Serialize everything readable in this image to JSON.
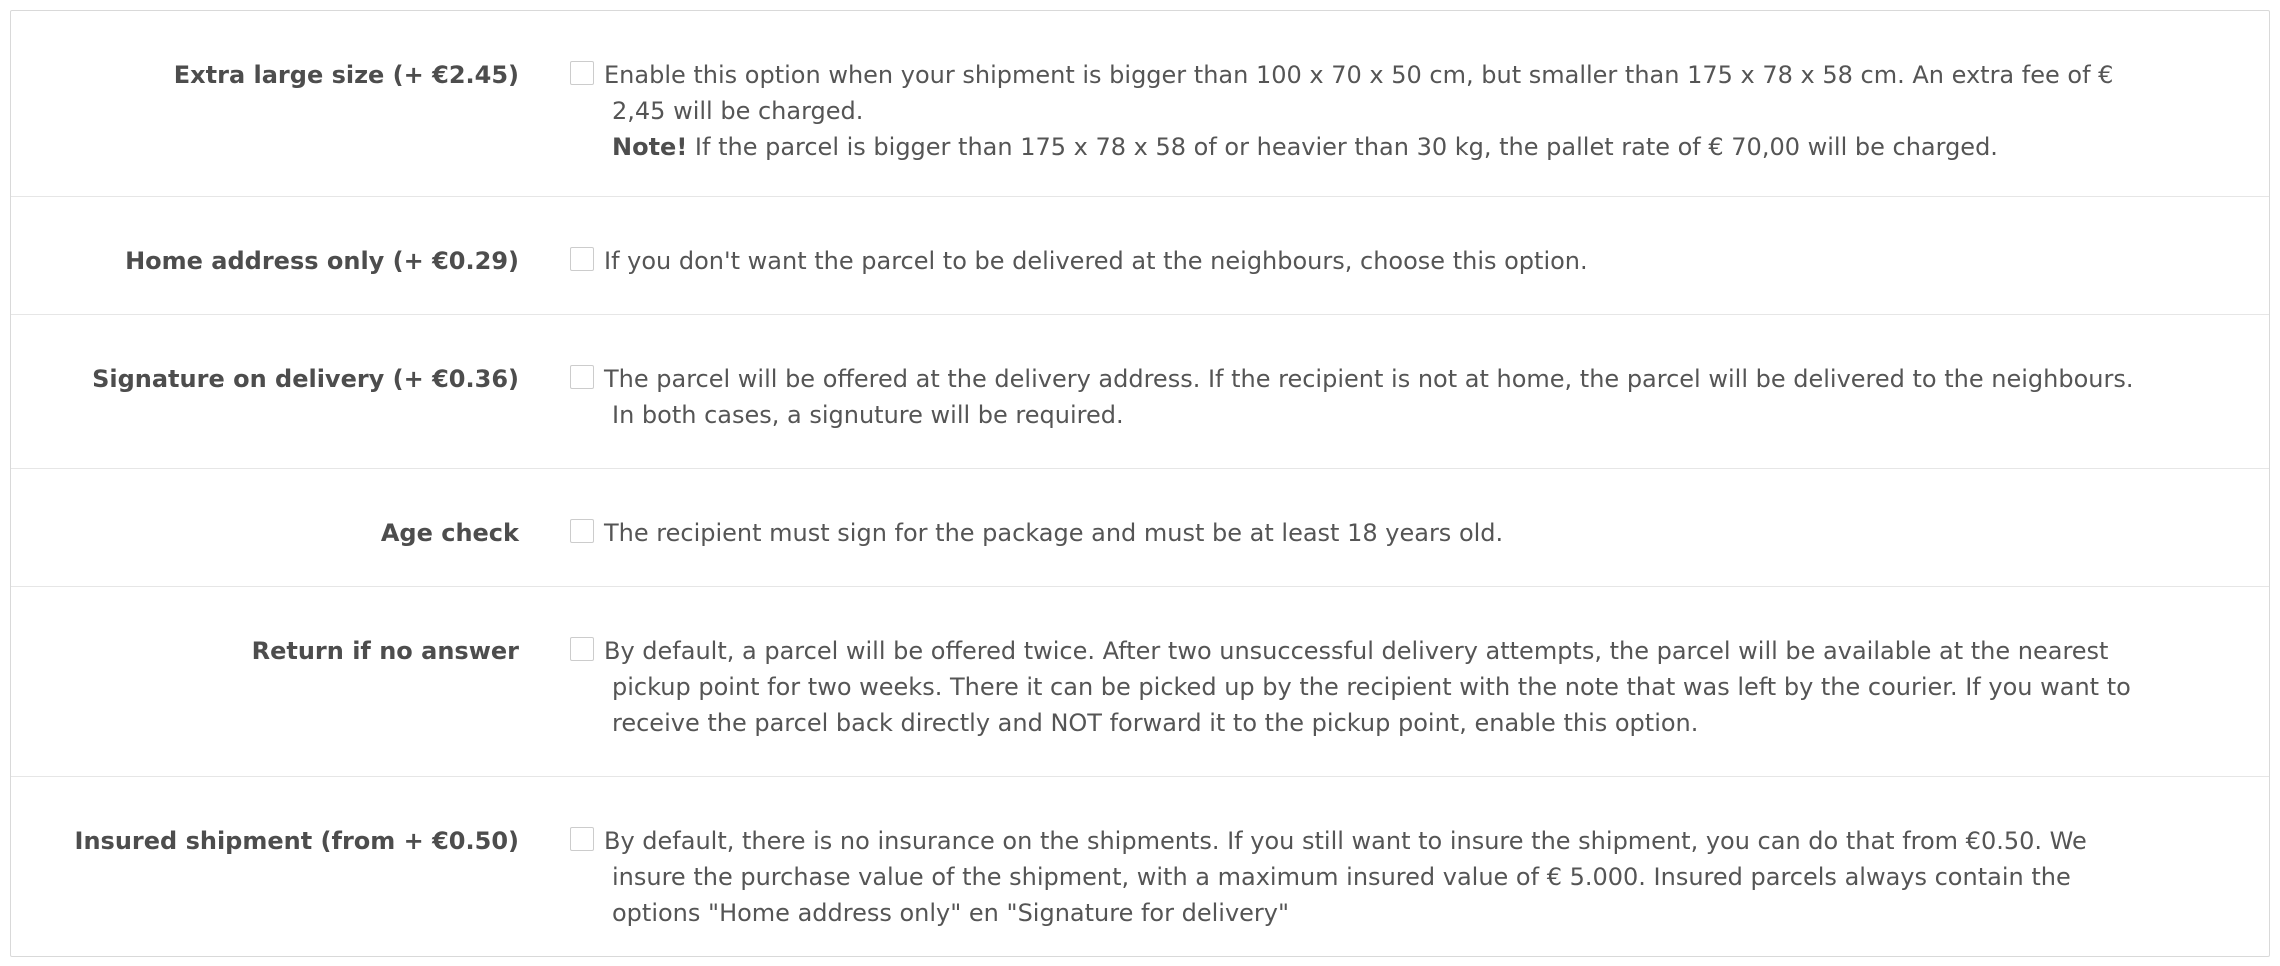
{
  "options": [
    {
      "label": "Extra large size (+ €2.45)",
      "description": "Enable this option when your shipment is bigger than 100 x 70 x 50 cm, but smaller than 175 x 78 x 58 cm. An extra fee of € 2,45 will be charged.",
      "note_label": "Note!",
      "note_text": " If the parcel is bigger than 175 x 78 x 58 of or heavier than 30 kg, the pallet rate of € 70,00 will be charged.",
      "checked": false
    },
    {
      "label": "Home address only (+ €0.29)",
      "description": "If you don't want the parcel to be delivered at the neighbours, choose this option.",
      "checked": false
    },
    {
      "label": "Signature on delivery (+ €0.36)",
      "description": "The parcel will be offered at the delivery address. If the recipient is not at home, the parcel will be delivered to the neighbours. In both cases, a signuture will be required.",
      "checked": false
    },
    {
      "label": "Age check",
      "description": "The recipient must sign for the package and must be at least 18 years old.",
      "checked": false
    },
    {
      "label": "Return if no answer",
      "description": "By default, a parcel will be offered twice. After two unsuccessful delivery attempts, the parcel will be available at the nearest pickup point for two weeks. There it can be picked up by the recipient with the note that was left by the courier. If you want to receive the parcel back directly and NOT forward it to the pickup point, enable this option.",
      "checked": false
    },
    {
      "label": "Insured shipment (from + €0.50)",
      "description": "By default, there is no insurance on the shipments. If you still want to insure the shipment, you can do that from €0.50. We insure the purchase value of the shipment, with a maximum insured value of € 5.000. Insured parcels always contain the options \"Home address only\" en \"Signature for delivery\"",
      "checked": false
    }
  ]
}
